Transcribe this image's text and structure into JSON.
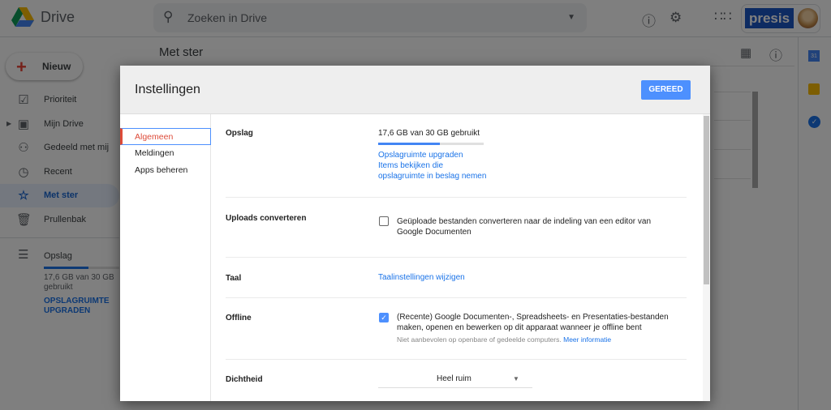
{
  "topbar": {
    "brand": "Drive",
    "search_placeholder": "Zoeken in Drive",
    "account_badge": "presis"
  },
  "sidebar": {
    "new_label": "Nieuw",
    "items": [
      {
        "label": "Prioriteit"
      },
      {
        "label": "Mijn Drive"
      },
      {
        "label": "Gedeeld met mij"
      },
      {
        "label": "Recent"
      },
      {
        "label": "Met ster"
      },
      {
        "label": "Prullenbak"
      }
    ],
    "storage": {
      "label": "Opslag",
      "usage": "17,6 GB van 30 GB gebruikt",
      "upgrade": "OPSLAGRUIMTE UPGRADEN",
      "used_fraction": 0.587
    }
  },
  "page": {
    "title": "Met ster"
  },
  "dialog": {
    "title": "Instellingen",
    "done_label": "GEREED",
    "nav": [
      {
        "label": "Algemeen"
      },
      {
        "label": "Meldingen"
      },
      {
        "label": "Apps beheren"
      }
    ],
    "storage": {
      "label": "Opslag",
      "usage": "17,6 GB van 30 GB gebruikt",
      "used_fraction": 0.587,
      "upgrade_link": "Opslagruimte upgraden",
      "items_link_1": "Items bekijken die",
      "items_link_2": "opslagruimte in beslag nemen"
    },
    "uploads": {
      "label": "Uploads converteren",
      "checkbox_text": "Geüploade bestanden converteren naar de indeling van een editor van Google Documenten",
      "checked": false
    },
    "language": {
      "label": "Taal",
      "link": "Taalinstellingen wijzigen"
    },
    "offline": {
      "label": "Offline",
      "checkbox_text": "(Recente) Google Documenten-, Spreadsheets- en Presentaties-bestanden maken, openen en bewerken op dit apparaat wanneer je offline bent",
      "note": "Niet aanbevolen op openbare of gedeelde computers.",
      "more_link": "Meer informatie",
      "checked": true
    },
    "density": {
      "label": "Dichtheid",
      "value": "Heel ruim"
    }
  }
}
